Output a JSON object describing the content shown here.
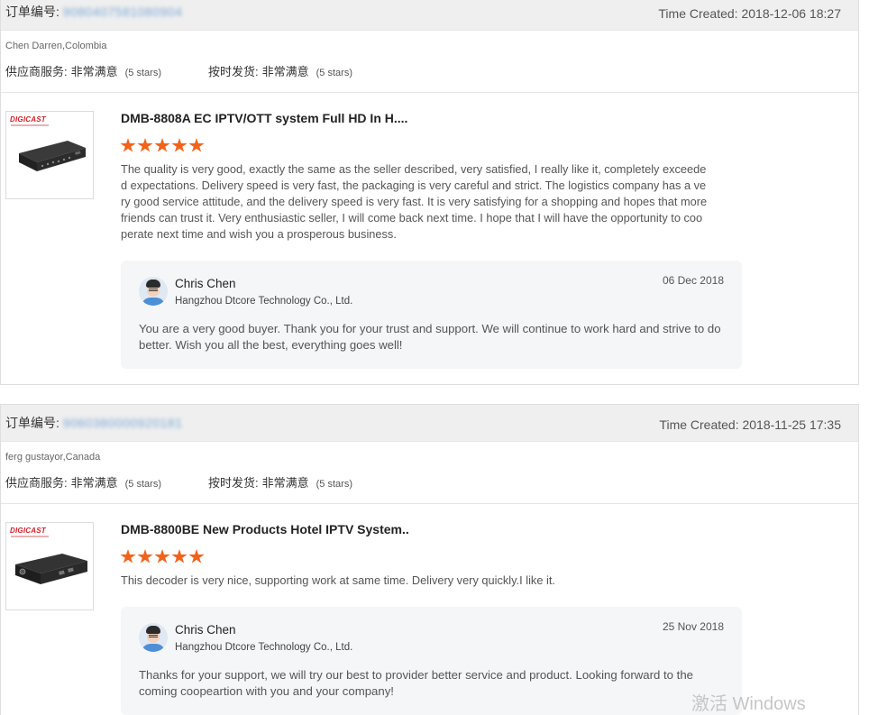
{
  "orders": [
    {
      "order_label": "订单编号:",
      "order_number": "9080407581080904",
      "time_created": "Time Created: 2018-12-06 18:27",
      "buyer": "Chen Darren,Colombia",
      "ratings": [
        {
          "label": "供应商服务:",
          "value": "非常满意",
          "stars": "(5 stars)"
        },
        {
          "label": "按时发货:",
          "value": "非常满意",
          "stars": "(5 stars)"
        }
      ],
      "product": {
        "logo": "DIGICAST",
        "title": "DMB-8808A EC IPTV/OTT system Full HD In H....",
        "rating_stars": 5,
        "review": "The quality is very good, exactly the same as the seller described, very satisfied, I really like it, completely exceeded expectations. Delivery speed is very fast, the packaging is very careful and strict. The logistics company has a very good service attitude, and the delivery speed is very fast. It is very satisfying for a shopping and hopes that more friends can trust it. Very enthusiastic seller, I will come back next time. I hope that I will have the opportunity to cooperate next time and wish you a prosperous business."
      },
      "reply": {
        "name": "Chris Chen",
        "company": "Hangzhou Dtcore Technology Co., Ltd.",
        "date": "06 Dec 2018",
        "text": "You are a very good buyer. Thank you for your trust and support. We will continue to work hard and strive to do better. Wish you all the best, everything goes well!"
      }
    },
    {
      "order_label": "订单编号:",
      "order_number": "9060380000920181",
      "time_created": "Time Created: 2018-11-25 17:35",
      "buyer": "ferg gustayor,Canada",
      "ratings": [
        {
          "label": "供应商服务:",
          "value": "非常满意",
          "stars": "(5 stars)"
        },
        {
          "label": "按时发货:",
          "value": "非常满意",
          "stars": "(5 stars)"
        }
      ],
      "product": {
        "logo": "DIGICAST",
        "title": "DMB-8800BE New Products Hotel IPTV System..",
        "rating_stars": 5,
        "review": "This decoder is very nice, supporting work at same time. Delivery very quickly.I like it."
      },
      "reply": {
        "name": "Chris Chen",
        "company": "Hangzhou Dtcore Technology Co., Ltd.",
        "date": "25 Nov 2018",
        "text": "Thanks for your support, we will try our best to provider better service and product. Looking forward to the coming coopeartion with you and your company!"
      }
    }
  ],
  "watermark": "激活 Windows"
}
